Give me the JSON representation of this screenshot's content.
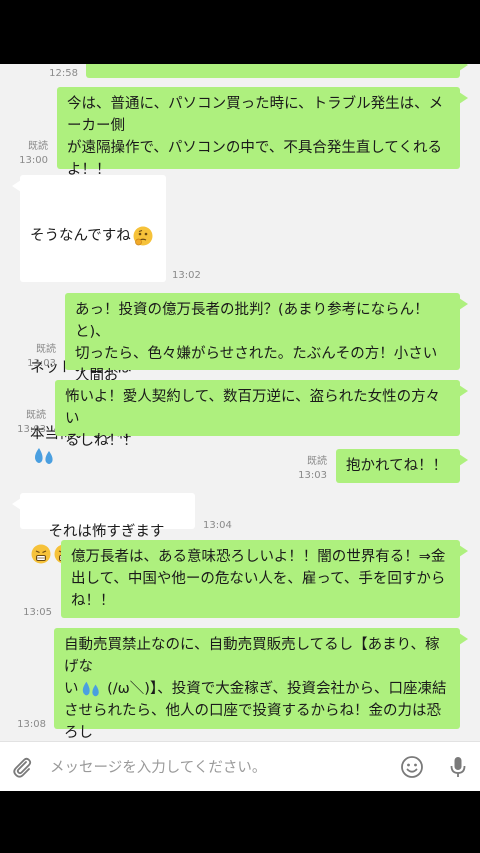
{
  "messages": [
    {
      "side": "me",
      "text": "",
      "read": "",
      "time": "12:58"
    },
    {
      "side": "me",
      "text": "今は、普通に、パソコン買った時に、トラブル発生は、メーカー側\nが遠隔操作で、パソコンの中で、不具合発生直してくれる\nよ！！",
      "read": "既読",
      "time": "13:00"
    },
    {
      "side": "them",
      "line1": "そうなんですね",
      "line2": "ネットの世界は",
      "line3": "本当怖いですね",
      "time": "13:02"
    },
    {
      "side": "me",
      "text": "あっ！投資の億万長者の批判？(あまり参考にならん！と)、\n切ったら、色々嫌がらせされた。たぶんその方！小さい人間お\nるからね！！",
      "read": "既読",
      "time": "13:03"
    },
    {
      "side": "me",
      "text": "怖いよ！愛人契約して、数百万逆に、盗られた女性の方々い\nるしね！！",
      "read": "既読",
      "time": "13:03"
    },
    {
      "side": "me",
      "text": "抱かれてね！！",
      "read": "既読",
      "time": "13:03"
    },
    {
      "side": "them",
      "text": "それは怖すぎます",
      "time": "13:04"
    },
    {
      "side": "me",
      "text": "億万長者は、ある意味恐ろしいよ！！闇の世界有る！⇒金\n出して、中国や他ーの危ない人を、雇って、手を回すから\nね！！",
      "read": "既読",
      "time": "13:05"
    },
    {
      "side": "me",
      "text_a": "自動売買禁止なのに、自動売買販売してるし【あまり、稼げな\nい",
      "text_b": " (/ω＼)】、投資で大金稼ぎ、投資会社から、口座凍結\nさせられたら、他人の口座で投資するからね！金の力は恐ろし\nいよ！！",
      "read": "既読",
      "time": "13:08"
    }
  ],
  "input": {
    "placeholder": "メッセージを入力してください。",
    "attach_icon": "paperclip-icon",
    "emoji_icon": "smiley-icon",
    "mic_icon": "microphone-icon"
  },
  "colors": {
    "my_bubble": "#aef07e",
    "their_bubble": "#ffffff",
    "background": "#f2f2f2"
  }
}
